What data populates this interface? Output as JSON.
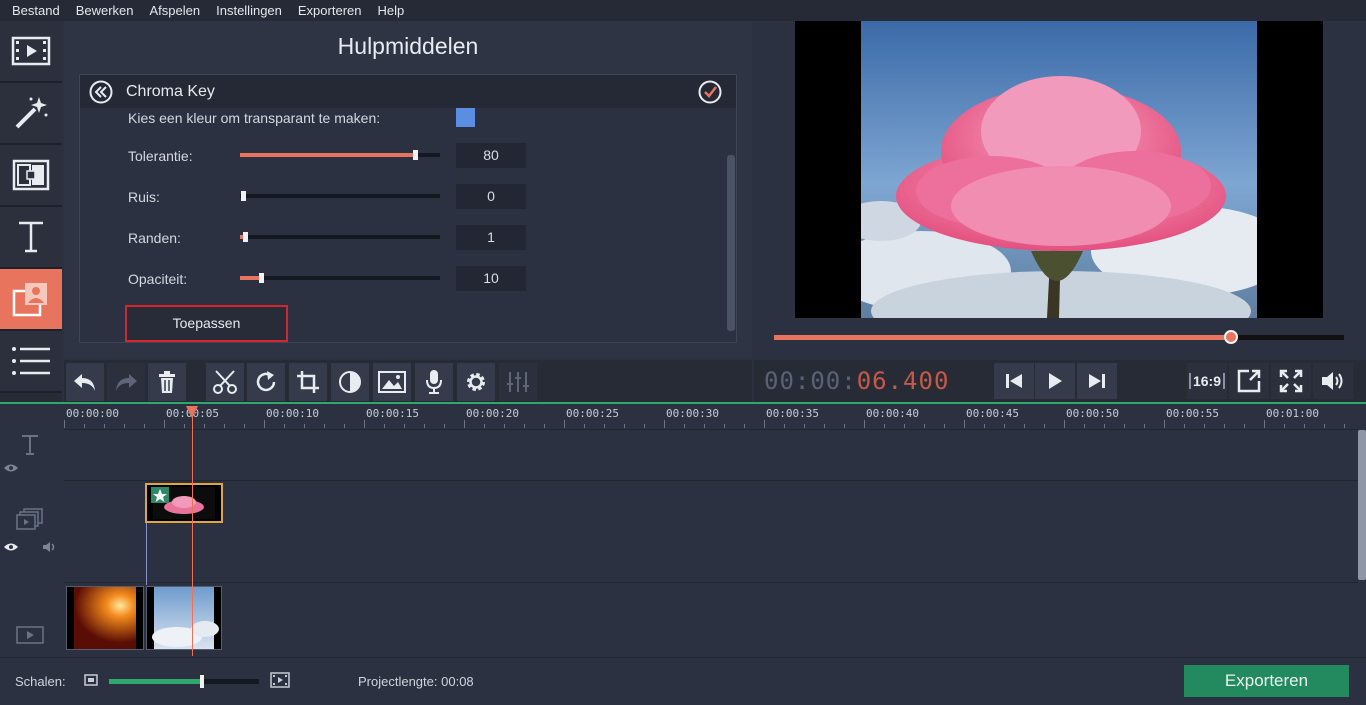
{
  "menu": [
    "Bestand",
    "Bewerken",
    "Afspelen",
    "Instellingen",
    "Exporteren",
    "Help"
  ],
  "nav": [
    "film-icon",
    "magic-wand-icon",
    "transition-icon",
    "titles-icon",
    "chroma-key-icon",
    "list-icon"
  ],
  "tools": {
    "title": "Hulpmiddelen",
    "panel_title": "Chroma Key",
    "color_prompt": "Kies een kleur om transparant te maken:",
    "key_color": "#5b8de0",
    "sliders": [
      {
        "label": "Tolerantie:",
        "value": "80",
        "level": 0.8
      },
      {
        "label": "Ruis:",
        "value": "0",
        "level": 0.0
      },
      {
        "label": "Randen:",
        "value": "1",
        "level": 0.01
      },
      {
        "label": "Opaciteit:",
        "value": "10",
        "level": 0.1
      }
    ],
    "apply_label": "Toepassen"
  },
  "player": {
    "timecode_dim": "00:00:",
    "timecode_lit": "06.400",
    "progress": 0.8,
    "aspect": "16:9"
  },
  "timeline": {
    "ticks": [
      "00:00:00",
      "00:00:05",
      "00:00:10",
      "00:00:15",
      "00:00:20",
      "00:00:25",
      "00:00:30",
      "00:00:35",
      "00:00:40",
      "00:00:45",
      "00:00:50",
      "00:00:55",
      "00:01:00"
    ]
  },
  "status": {
    "scale_label": "Schalen:",
    "scale_level": 0.62,
    "project_length_label": "Projectlengte:",
    "project_length": "00:08",
    "export_label": "Exporteren"
  },
  "colors": {
    "accent": "#e8745e",
    "export": "#23895f",
    "timeline_line": "#2ea86d"
  }
}
